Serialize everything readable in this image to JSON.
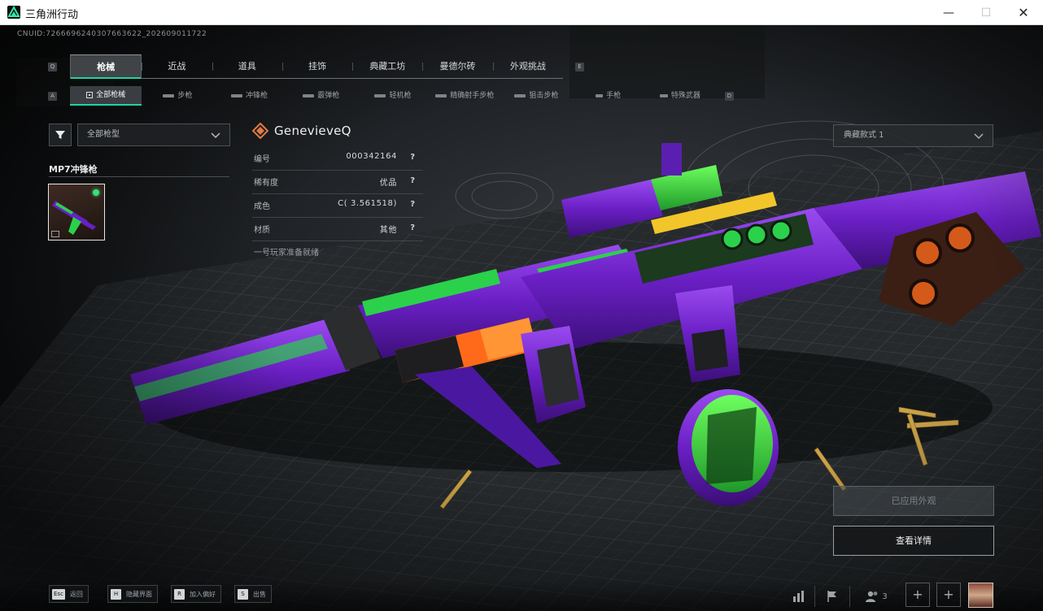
{
  "window": {
    "title": "三角洲行动",
    "minimize": "—",
    "maximize": "☐",
    "close": "✕"
  },
  "uid": "CNUID:7266696240307663622_202609011722",
  "tabs": {
    "prev_key": "Q",
    "next_key": "E",
    "items": [
      "枪械",
      "近战",
      "道具",
      "挂饰",
      "典藏工坊",
      "曼德尔砖",
      "外观挑战"
    ],
    "active": "枪械"
  },
  "subtabs": {
    "prev_key": "A",
    "next_key": "D",
    "items": [
      "全部枪械",
      "步枪",
      "冲锋枪",
      "霰弹枪",
      "轻机枪",
      "精确射手步枪",
      "狙击步枪",
      "手枪",
      "特殊武器"
    ],
    "active": "全部枪械"
  },
  "filter": {
    "selected": "全部枪型"
  },
  "category": "MP7冲锋枪",
  "skin": {
    "name": "GenevieveQ",
    "rows": [
      {
        "label": "编号",
        "value": "000342164",
        "help": "?"
      },
      {
        "label": "稀有度",
        "value": "优品",
        "help": "?"
      },
      {
        "label": "成色",
        "value": "C( 3.561518)",
        "help": "?"
      },
      {
        "label": "材质",
        "value": "其他",
        "help": "?"
      }
    ],
    "description": "一号玩家准备就绪"
  },
  "style_select": "典藏款式 1",
  "buttons": {
    "applied": "已应用外观",
    "details": "查看详情"
  },
  "hotkeys": [
    {
      "key": "Esc",
      "label": "返回"
    },
    {
      "key": "H",
      "label": "隐藏界面"
    },
    {
      "key": "R",
      "label": "加入偏好"
    },
    {
      "key": "S",
      "label": "出售"
    }
  ],
  "social": {
    "friend_count": "3",
    "plus": "+"
  },
  "colors": {
    "accent": "#1fd4a6",
    "gun_purple": "#6a1fc4",
    "gun_green": "#2bd14a"
  }
}
